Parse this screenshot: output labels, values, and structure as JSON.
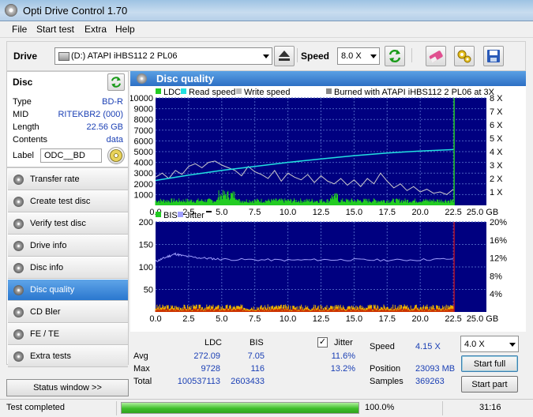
{
  "window": {
    "title": "Opti Drive Control 1.70"
  },
  "menu": [
    "File",
    "Start test",
    "Extra",
    "Help"
  ],
  "toolbar": {
    "drive_label": "Drive",
    "drive_value": "(D:)   ATAPI iHBS112   2 PL06",
    "speed_label": "Speed",
    "speed_value": "8.0 X"
  },
  "disc": {
    "header": "Disc",
    "rows": [
      {
        "label": "Type",
        "value": "BD-R"
      },
      {
        "label": "MID",
        "value": "RITEKBR2 (000)"
      },
      {
        "label": "Length",
        "value": "22.56 GB"
      },
      {
        "label": "Contents",
        "value": "data"
      }
    ],
    "label_label": "Label",
    "label_value": "ODC__BD"
  },
  "nav": [
    {
      "label": "Transfer rate",
      "active": false
    },
    {
      "label": "Create test disc",
      "active": false
    },
    {
      "label": "Verify test disc",
      "active": false
    },
    {
      "label": "Drive info",
      "active": false
    },
    {
      "label": "Disc info",
      "active": false
    },
    {
      "label": "Disc quality",
      "active": true
    },
    {
      "label": "CD Bler",
      "active": false
    },
    {
      "label": "FE / TE",
      "active": false
    },
    {
      "label": "Extra tests",
      "active": false
    }
  ],
  "status_window_button": "Status window >>",
  "panel_title": "Disc quality",
  "chart_data": [
    {
      "type": "line",
      "legend": [
        "LDC",
        "Read speed",
        "Write speed",
        "Burned with ATAPI iHBS112   2 PL06 at 3X"
      ],
      "colors": {
        "ldc": "#22cc22",
        "read": "#22e0e0",
        "write": "#cccccc",
        "bg": "#000080",
        "grid": "#4a5fc0"
      },
      "x_ticks": [
        "0.0",
        "2.5",
        "5.0",
        "7.5",
        "10.0",
        "12.5",
        "15.0",
        "17.5",
        "20.0",
        "22.5",
        "25.0 GB"
      ],
      "y_ticks_left": [
        "10000",
        "9000",
        "8000",
        "7000",
        "6000",
        "5000",
        "4000",
        "3000",
        "2000",
        "1000"
      ],
      "y_ticks_right": [
        "8 X",
        "7 X",
        "6 X",
        "5 X",
        "4 X",
        "3 X",
        "2 X",
        "1 X"
      ],
      "xlim": [
        0,
        25
      ],
      "ylim": [
        0,
        10000
      ],
      "speed_lim": [
        0,
        8
      ],
      "read_speed": {
        "x": [
          0,
          2.5,
          5,
          7.5,
          10,
          12.5,
          15,
          17.5,
          20,
          22.5
        ],
        "y": [
          1.85,
          2.25,
          2.6,
          2.9,
          3.2,
          3.45,
          3.7,
          3.9,
          4.05,
          4.15
        ]
      },
      "write_speed": {
        "x": [
          0,
          0.5,
          1,
          1.5,
          2,
          2.5,
          3,
          3.5,
          4,
          4.5,
          5,
          5.5,
          6,
          6.5,
          7,
          7.5,
          8,
          8.5,
          9,
          9.5,
          10,
          10.5,
          11,
          11.5,
          12,
          12.5,
          13,
          13.5,
          14,
          14.5,
          15,
          15.5,
          16,
          16.5,
          17,
          17.5,
          18,
          18.5,
          19,
          19.5,
          20,
          20.5,
          21,
          21.5,
          22,
          22.5
        ],
        "y": [
          2.1,
          2.4,
          2.0,
          2.6,
          2.3,
          2.9,
          3.1,
          2.8,
          3.2,
          3.3,
          3.0,
          2.8,
          2.6,
          2.2,
          2.9,
          2.5,
          2.3,
          2.0,
          2.6,
          1.8,
          2.4,
          2.1,
          1.9,
          2.3,
          1.7,
          2.2,
          1.8,
          1.6,
          2.0,
          1.5,
          1.9,
          1.4,
          2.0,
          1.6,
          2.4,
          1.8,
          1.3,
          1.6,
          1.1,
          1.4,
          1.0,
          1.2,
          0.9,
          1.0,
          0.8,
          1.2
        ]
      },
      "ldc_avg": 272.09,
      "end_marker_gb": 22.56
    },
    {
      "type": "line",
      "legend": [
        "BIS",
        "Jitter"
      ],
      "colors": {
        "bis": "#e8b000",
        "jitter": "#a0a0ff",
        "bg": "#000080",
        "grid": "#4a5fc0"
      },
      "x_ticks": [
        "0.0",
        "2.5",
        "5.0",
        "7.5",
        "10.0",
        "12.5",
        "15.0",
        "17.5",
        "20.0",
        "22.5",
        "25.0 GB"
      ],
      "y_ticks_left": [
        "200",
        "150",
        "100",
        "50"
      ],
      "y_ticks_right": [
        "20%",
        "16%",
        "12%",
        "8%",
        "4%"
      ],
      "xlim": [
        0,
        25
      ],
      "ylim": [
        0,
        200
      ],
      "jitter_lim": [
        0,
        20
      ],
      "jitter": {
        "x": [
          0,
          0.5,
          1,
          1.5,
          2,
          3,
          4,
          5,
          7.5,
          10,
          12.5,
          15,
          17.5,
          20,
          22.5
        ],
        "y": [
          11.2,
          11.8,
          12.4,
          12.9,
          12.5,
          12.1,
          11.9,
          11.7,
          11.6,
          11.5,
          11.6,
          11.6,
          11.5,
          11.6,
          11.8
        ]
      },
      "bis_avg": 7.05,
      "end_marker_gb": 22.56
    }
  ],
  "stats": {
    "col_ldc": "LDC",
    "col_bis": "BIS",
    "col_jitter": "Jitter",
    "jitter_checked": true,
    "rows": [
      {
        "label": "Avg",
        "ldc": "272.09",
        "bis": "7.05",
        "jitter": "11.6%"
      },
      {
        "label": "Max",
        "ldc": "9728",
        "bis": "116",
        "jitter": "13.2%"
      },
      {
        "label": "Total",
        "ldc": "100537113",
        "bis": "2603433",
        "jitter": ""
      }
    ],
    "speed_label": "Speed",
    "speed_value": "4.15 X",
    "position_label": "Position",
    "position_value": "23093 MB",
    "samples_label": "Samples",
    "samples_value": "369263",
    "speed_select": "4.0 X",
    "start_full": "Start full",
    "start_part": "Start part"
  },
  "statusbar": {
    "text": "Test completed",
    "progress": 1.0,
    "progress_label": "100.0%",
    "time": "31:16"
  }
}
